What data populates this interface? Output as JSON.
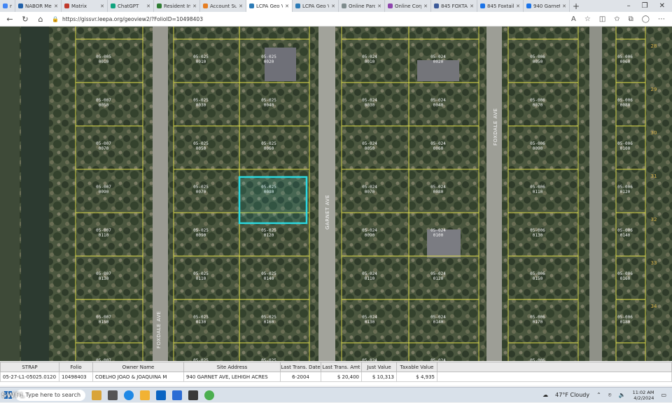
{
  "browser": {
    "tabs": [
      {
        "label": "n",
        "color": "#4285f4"
      },
      {
        "label": "NABOR Me",
        "color": "#1f5fa8"
      },
      {
        "label": "Matrix",
        "color": "#c0392b"
      },
      {
        "label": "ChatGPT",
        "color": "#10a37f"
      },
      {
        "label": "Resident Info",
        "color": "#2e7d32"
      },
      {
        "label": "Account Sum",
        "color": "#e67e22"
      },
      {
        "label": "LCPA Geo V",
        "color": "#2c7bb6",
        "active": true
      },
      {
        "label": "LCPA Geo V",
        "color": "#2c7bb6"
      },
      {
        "label": "Online Parc",
        "color": "#7f8c8d"
      },
      {
        "label": "Online Corp",
        "color": "#8e44ad"
      },
      {
        "label": "845 FOXTAI",
        "color": "#3b5998"
      },
      {
        "label": "845 Foxtail",
        "color": "#1a73e8"
      },
      {
        "label": "940 Garnet",
        "color": "#1a73e8"
      }
    ],
    "new_tab": "+",
    "window_controls": [
      "–",
      "❐",
      "✕"
    ],
    "url": "https://gissvr.leepa.org/geoview2/?FolioID=10498403"
  },
  "map": {
    "streets": [
      "GARNET AVE",
      "FOXDALE AVE",
      "FOXDALE AVE"
    ],
    "blocks": [
      "28",
      "29",
      "30",
      "31",
      "32",
      "33",
      "34"
    ],
    "lots_col_a": [
      "05-005\n0010",
      "05-007\n0050",
      "05-007\n0070",
      "05-007\n0090",
      "05-007\n0110",
      "05-007\n0130",
      "05-007\n0150",
      "05-007\n0170"
    ],
    "lots_col_b": [
      "05-025\n0010",
      "05-025\n0030",
      "05-025\n0050",
      "05-025\n0070",
      "05-025\n0090",
      "05-025\n0110",
      "05-025\n0130",
      "05-025\n0150"
    ],
    "lots_col_c": [
      "05-025\n0020",
      "05-025\n0040",
      "05-025\n0060",
      "05-025\n0080",
      "05-025\n0120",
      "05-025\n0140",
      "05-025\n0160",
      "05-025\n0180"
    ],
    "lots_col_d": [
      "05-024\n0010",
      "05-024\n0030",
      "05-024\n0050",
      "05-024\n0070",
      "05-024\n0090",
      "05-024\n0110",
      "05-024\n0130",
      "05-024\n0150"
    ],
    "lots_col_e": [
      "05-024\n0020",
      "05-024\n0040",
      "05-024\n0060",
      "05-024\n0080",
      "05-024\n0100",
      "05-024\n0120",
      "05-024\n0140",
      "05-024\n0160"
    ],
    "lots_col_f": [
      "05-006\n0050",
      "05-006\n0070",
      "05-006\n0090",
      "05-006\n0110",
      "05-006\n0130",
      "05-006\n0150",
      "05-006\n0170",
      "05-006\n0190"
    ],
    "lots_col_g": [
      "05-006\n0060",
      "05-006\n0080",
      "05-006\n0100",
      "05-006\n0120",
      "05-006\n0140",
      "05-006\n0160",
      "05-006\n0180"
    ],
    "highlight_color": "#2bd9e0",
    "parcel_line_color": "#e6e24c"
  },
  "table": {
    "headers": [
      "STRAP",
      "Folio",
      "Owner Name",
      "Site Address",
      "Last Trans. Date",
      "Last Trans. Amt",
      "Just Value",
      "Taxable Value"
    ],
    "row": [
      "05-27-L1-05025.0120",
      "10498403",
      "COELHO JOAO & JOAQUINA M",
      "940 GARNET AVE, LEHIGH ACRES",
      "6-2004",
      "$ 20,400",
      "$ 10,313",
      "$ 4,935"
    ]
  },
  "taskbar": {
    "search_placeholder": "Type here to search",
    "weather": "47°F  Cloudy",
    "time": "11:02 AM",
    "date": "4/2/2024"
  },
  "watermark": "SWFL"
}
